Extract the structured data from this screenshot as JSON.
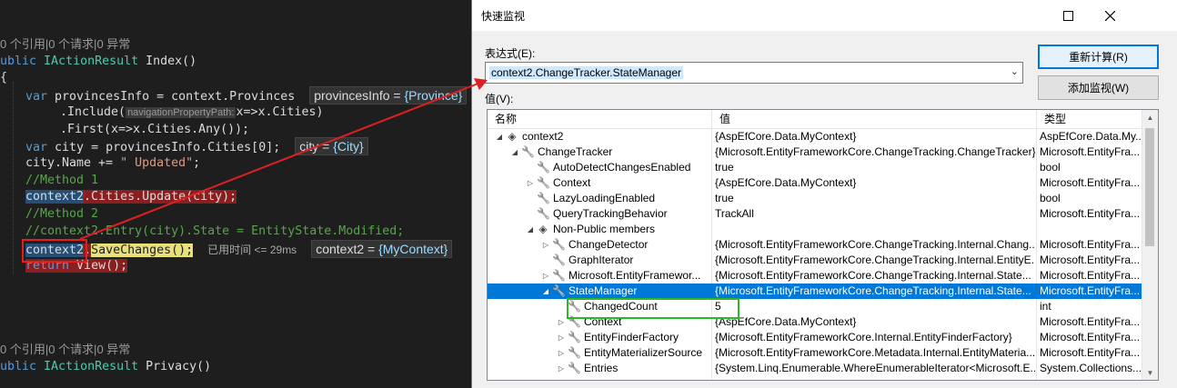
{
  "editor": {
    "lens1": "0 个引用|0 个请求|0 异常",
    "sig1_kw": "ublic",
    "sig1_type": "IActionResult",
    "sig1_name": " Index()",
    "brace": "{",
    "l1_kw": "var",
    "l1_rest": " provincesInfo = context.Provinces",
    "l1_tip_name": "provincesInfo = ",
    "l1_tip_val": "{Province}",
    "l2_a": ".Include(",
    "l2_hint": "navigationPropertyPath:",
    "l2_b": "x=>x.Cities)",
    "l3": ".First(x=>x.Cities.Any());",
    "l4_kw": "var",
    "l4_rest": " city = provincesInfo.Cities[0];",
    "l4_tip_name": "city = ",
    "l4_tip_val": "{City}",
    "l5_a": "city.Name += ",
    "l5_str": "\" Updated\"",
    "l5_b": ";",
    "l6": "//Method 1",
    "l7_sel": "context2",
    "l7_rest": ".Cities.Update(city);",
    "l8": "//Method 2",
    "l9": "//context2.Entry(city).State = EntityState.Modified;",
    "l10_sel": "context2",
    "l10_dot": ".",
    "l10_call": "SaveChanges();",
    "l10_elapsed": "已用时间 <= 29ms",
    "l10_tip_name": "context2 = ",
    "l10_tip_val": "{MyContext}",
    "l11_kw": "return",
    "l11_rest": " View();",
    "lens2": "0 个引用|0 个请求|0 异常",
    "sig2_kw": "ublic",
    "sig2_type": "IActionResult",
    "sig2_name": " Privacy()"
  },
  "dialog": {
    "title": "快速监视",
    "expr_label": "表达式(E):",
    "expression": "context2.ChangeTracker.StateManager",
    "value_label": "值(V):",
    "recalc_button": "重新计算(R)",
    "add_watch_button": "添加监视(W)",
    "columns": [
      "名称",
      "值",
      "类型"
    ],
    "rows": [
      {
        "indent": 0,
        "expander": "open",
        "icon": "object-icon",
        "name": "context2",
        "value": "{AspEfCore.Data.MyContext}",
        "type": "AspEfCore.Data.My..."
      },
      {
        "indent": 1,
        "expander": "open",
        "icon": "wrench-icon",
        "name": "ChangeTracker",
        "value": "{Microsoft.EntityFrameworkCore.ChangeTracking.ChangeTracker}",
        "type": "Microsoft.EntityFra..."
      },
      {
        "indent": 2,
        "expander": "none",
        "icon": "wrench-icon",
        "name": "AutoDetectChangesEnabled",
        "value": "true",
        "type": "bool"
      },
      {
        "indent": 2,
        "expander": "closed",
        "icon": "wrench-icon",
        "name": "Context",
        "value": "{AspEfCore.Data.MyContext}",
        "type": "Microsoft.EntityFra..."
      },
      {
        "indent": 2,
        "expander": "none",
        "icon": "wrench-icon",
        "name": "LazyLoadingEnabled",
        "value": "true",
        "type": "bool"
      },
      {
        "indent": 2,
        "expander": "none",
        "icon": "wrench-icon",
        "name": "QueryTrackingBehavior",
        "value": "TrackAll",
        "type": "Microsoft.EntityFra..."
      },
      {
        "indent": 2,
        "expander": "open",
        "icon": "object-icon",
        "name": "Non-Public members",
        "value": "",
        "type": ""
      },
      {
        "indent": 3,
        "expander": "closed",
        "icon": "lock-wrench-icon",
        "name": "ChangeDetector",
        "value": "{Microsoft.EntityFrameworkCore.ChangeTracking.Internal.Chang...",
        "type": "Microsoft.EntityFra..."
      },
      {
        "indent": 3,
        "expander": "none",
        "icon": "lock-wrench-icon",
        "name": "GraphIterator",
        "value": "{Microsoft.EntityFrameworkCore.ChangeTracking.Internal.EntityE...",
        "type": "Microsoft.EntityFra..."
      },
      {
        "indent": 3,
        "expander": "closed",
        "icon": "lock-wrench-icon",
        "name": "Microsoft.EntityFramewor...",
        "value": "{Microsoft.EntityFrameworkCore.ChangeTracking.Internal.State...",
        "type": "Microsoft.EntityFra..."
      },
      {
        "indent": 3,
        "expander": "open",
        "icon": "lock-wrench-icon",
        "name": "StateManager",
        "value": "{Microsoft.EntityFrameworkCore.ChangeTracking.Internal.State...",
        "type": "Microsoft.EntityFra...",
        "selected": true
      },
      {
        "indent": 4,
        "expander": "none",
        "icon": "wrench-icon",
        "name": "ChangedCount",
        "value": "5",
        "type": "int"
      },
      {
        "indent": 4,
        "expander": "closed",
        "icon": "wrench-icon",
        "name": "Context",
        "value": "{AspEfCore.Data.MyContext}",
        "type": "Microsoft.EntityFra..."
      },
      {
        "indent": 4,
        "expander": "closed",
        "icon": "wrench-icon",
        "name": "EntityFinderFactory",
        "value": "{Microsoft.EntityFrameworkCore.Internal.EntityFinderFactory}",
        "type": "Microsoft.EntityFra..."
      },
      {
        "indent": 4,
        "expander": "closed",
        "icon": "wrench-icon",
        "name": "EntityMaterializerSource",
        "value": "{Microsoft.EntityFrameworkCore.Metadata.Internal.EntityMateria...",
        "type": "Microsoft.EntityFra..."
      },
      {
        "indent": 4,
        "expander": "closed",
        "icon": "wrench-icon",
        "name": "Entries",
        "value": "{System.Linq.Enumerable.WhereEnumerableIterator<Microsoft.E...",
        "type": "System.Collections...."
      }
    ]
  }
}
